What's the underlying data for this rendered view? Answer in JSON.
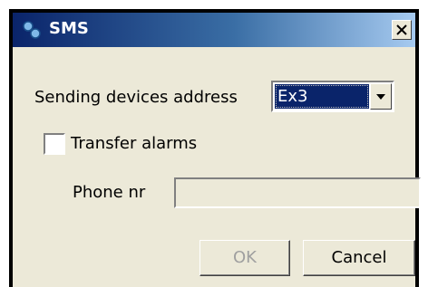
{
  "window": {
    "title": "SMS",
    "icon": "sms-app-icon",
    "close_icon": "close-icon",
    "accent": "#0a246a"
  },
  "form": {
    "sending_devices_label": "Sending devices address",
    "sending_devices_value": "Ex3",
    "transfer_alarms_label": "Transfer alarms",
    "transfer_alarms_checked": false,
    "phone_label": "Phone nr",
    "phone_value": ""
  },
  "buttons": {
    "ok_label": "OK",
    "ok_enabled": false,
    "cancel_label": "Cancel"
  }
}
